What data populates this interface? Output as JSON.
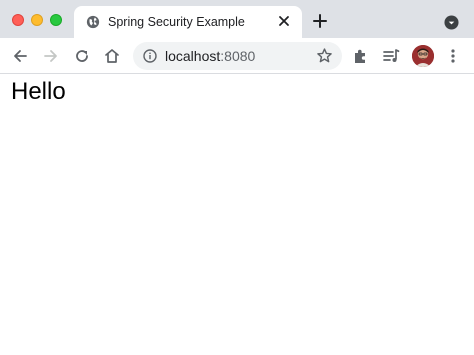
{
  "window": {
    "traffic_lights": [
      "close",
      "minimize",
      "zoom"
    ]
  },
  "tab": {
    "title": "Spring Security Example",
    "favicon": "globe-icon"
  },
  "toolbar": {
    "url_host": "localhost",
    "url_port": ":8080"
  },
  "page": {
    "heading": "Hello"
  }
}
